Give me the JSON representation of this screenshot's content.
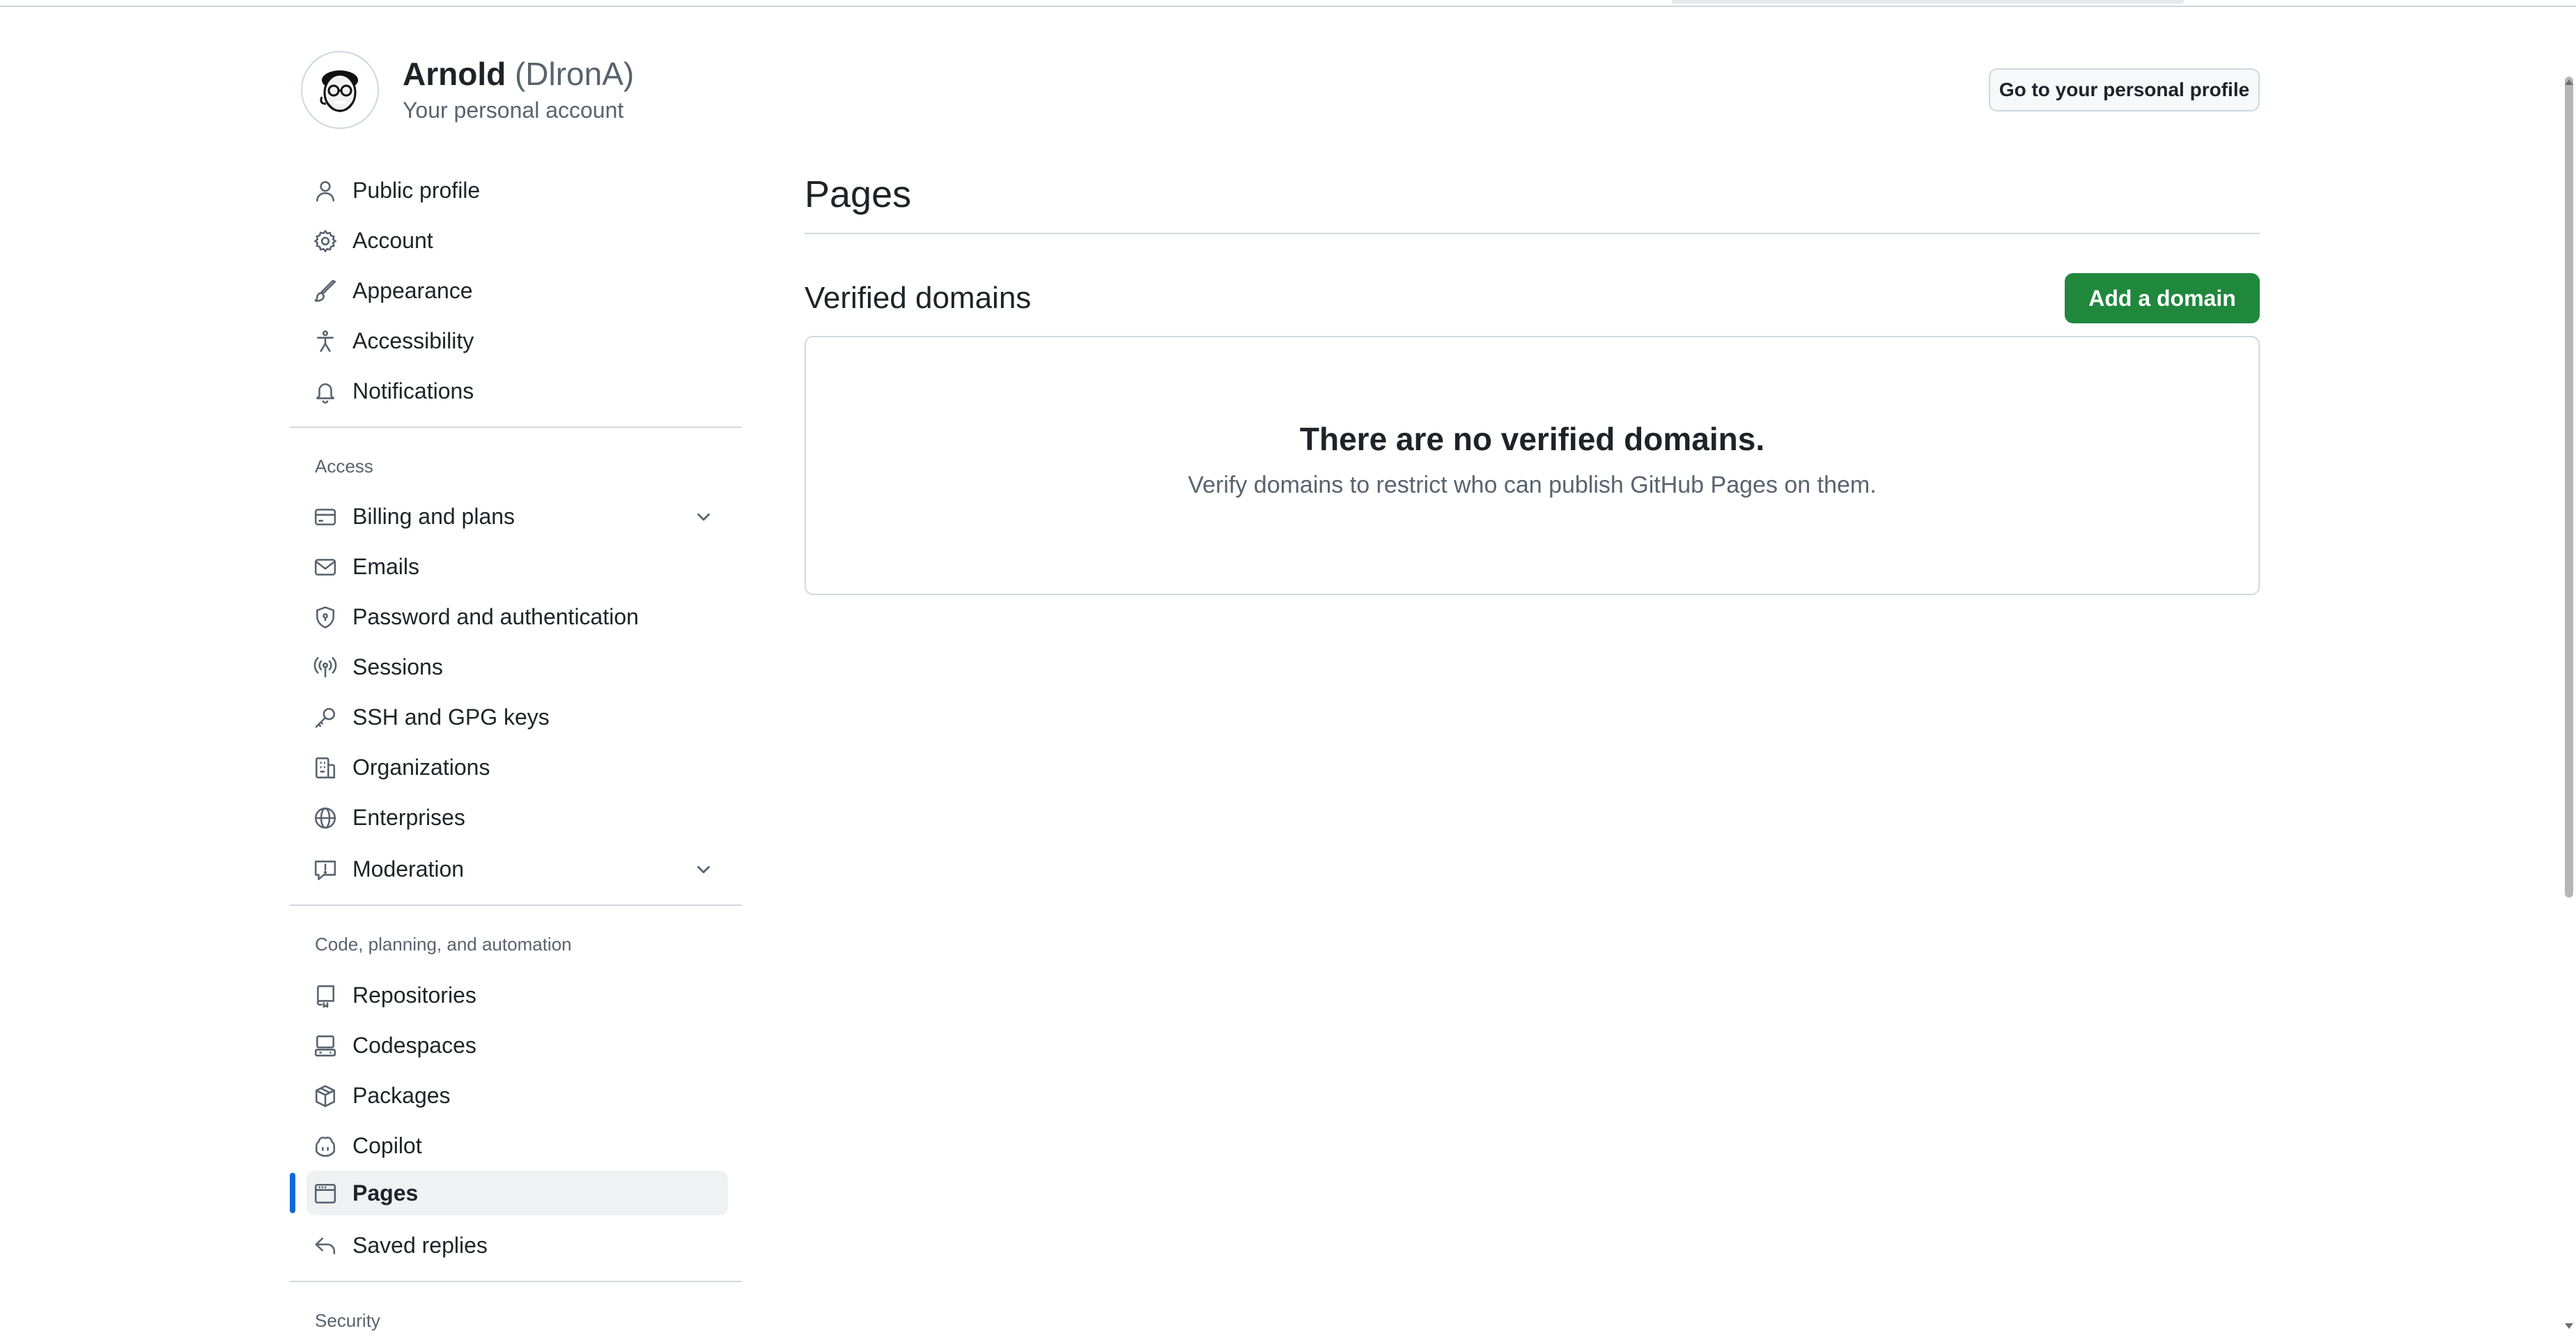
{
  "account": {
    "name": "Arnold",
    "login": "(DlronA)",
    "subtitle": "Your personal account",
    "profile_button": "Go to your personal profile"
  },
  "sidebar": {
    "top_items": [
      {
        "label": "Public profile",
        "icon": "person-icon"
      },
      {
        "label": "Account",
        "icon": "gear-icon"
      },
      {
        "label": "Appearance",
        "icon": "paintbrush-icon"
      },
      {
        "label": "Accessibility",
        "icon": "accessibility-icon"
      },
      {
        "label": "Notifications",
        "icon": "bell-icon"
      }
    ],
    "access": {
      "heading": "Access",
      "items": [
        {
          "label": "Billing and plans",
          "icon": "credit-card-icon",
          "expandable": true
        },
        {
          "label": "Emails",
          "icon": "mail-icon"
        },
        {
          "label": "Password and authentication",
          "icon": "shield-lock-icon"
        },
        {
          "label": "Sessions",
          "icon": "broadcast-icon"
        },
        {
          "label": "SSH and GPG keys",
          "icon": "key-icon"
        },
        {
          "label": "Organizations",
          "icon": "organization-icon"
        },
        {
          "label": "Enterprises",
          "icon": "globe-icon"
        },
        {
          "label": "Moderation",
          "icon": "report-icon",
          "expandable": true
        }
      ]
    },
    "code": {
      "heading": "Code, planning, and automation",
      "items": [
        {
          "label": "Repositories",
          "icon": "repo-icon"
        },
        {
          "label": "Codespaces",
          "icon": "codespaces-icon"
        },
        {
          "label": "Packages",
          "icon": "package-icon"
        },
        {
          "label": "Copilot",
          "icon": "copilot-icon"
        },
        {
          "label": "Pages",
          "icon": "browser-icon",
          "active": true
        },
        {
          "label": "Saved replies",
          "icon": "reply-icon"
        }
      ]
    },
    "security": {
      "heading": "Security"
    }
  },
  "main": {
    "title": "Pages",
    "section_title": "Verified domains",
    "add_button": "Add a domain",
    "blankslate": {
      "title": "There are no verified domains.",
      "description": "Verify domains to restrict who can publish GitHub Pages on them."
    }
  },
  "colors": {
    "accent_blue": "#0969da",
    "primary_green": "#1f883d",
    "muted_text": "#59636e",
    "border": "#d1d9e0"
  }
}
